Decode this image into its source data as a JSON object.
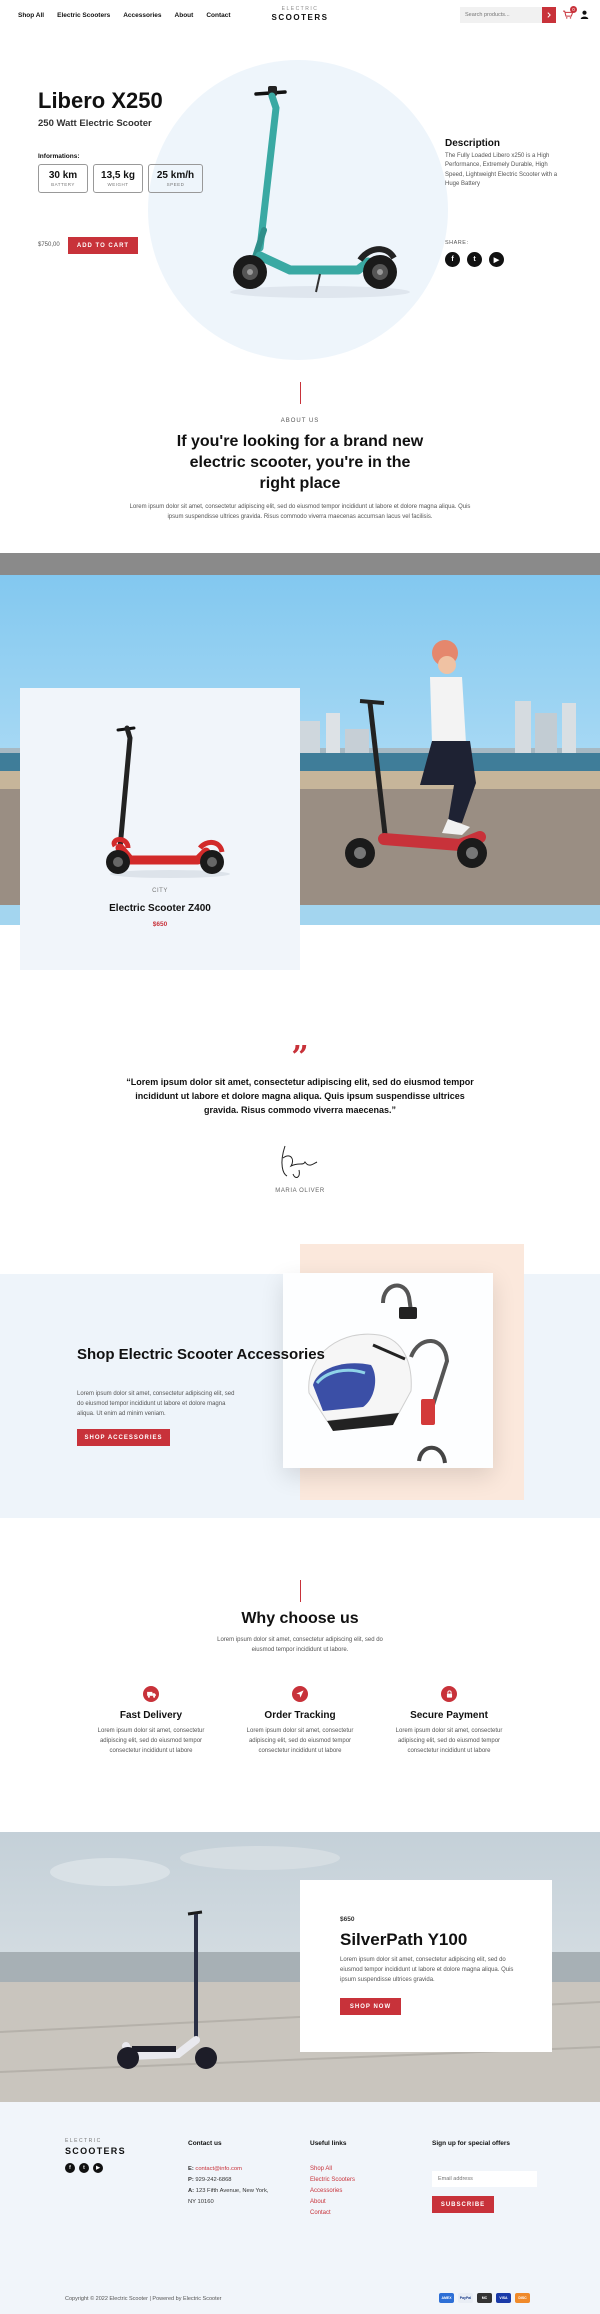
{
  "header": {
    "nav": [
      "Shop All",
      "Electric Scooters",
      "Accessories",
      "About",
      "Contact"
    ],
    "brand_small": "ELECTRIC",
    "brand_big": "SCOOTERS",
    "search_placeholder": "Search products...",
    "cart_count": "0"
  },
  "hero": {
    "title": "Libero X250",
    "subtitle": "250 Watt Electric Scooter",
    "info_label": "Informations:",
    "specs": [
      {
        "value": "30 km",
        "label": "BATTERY"
      },
      {
        "value": "13,5 kg",
        "label": "WEIGHT"
      },
      {
        "value": "25 km/h",
        "label": "SPEED"
      }
    ],
    "price": "$750,00",
    "add_to_cart": "ADD TO CART",
    "description_title": "Description",
    "description_text": "The Fully Loaded Libero x250 is a High Performance, Extremely Durable, High Speed, Lightweight Electric Scooter with a Huge Battery",
    "share_label": "SHARE:"
  },
  "about": {
    "label": "ABOUT US",
    "title": "If you're looking for a brand new electric scooter, you're in the right place",
    "text": "Lorem ipsum dolor sit amet, consectetur adipiscing elit, sed do eiusmod tempor incididunt ut labore et dolore magna aliqua. Quis ipsum suspendisse ultrices gravida. Risus commodo viverra maecenas accumsan lacus vel facilisis."
  },
  "featured": {
    "category": "CITY",
    "name": "Electric Scooter Z400",
    "price": "$650"
  },
  "testimonial": {
    "quote": "“Lorem ipsum dolor sit amet, consectetur adipiscing elit, sed do eiusmod tempor incididunt ut labore et dolore magna aliqua. Quis ipsum suspendisse ultrices gravida. Risus commodo viverra maecenas.”",
    "name": "MARIA OLIVER"
  },
  "accessories": {
    "title": "Shop Electric Scooter Accessories",
    "text": "Lorem ipsum dolor sit amet, consectetur adipiscing elit, sed do eiusmod tempor incididunt ut labore et dolore magna aliqua. Ut enim ad minim veniam.",
    "button": "SHOP ACCESSORIES"
  },
  "why": {
    "title": "Why choose us",
    "subtitle": "Lorem ipsum dolor sit amet, consectetur adipiscing elit, sed do eiusmod tempor incididunt ut labore.",
    "features": [
      {
        "title": "Fast Delivery",
        "text": "Lorem ipsum dolor sit amet, consectetur adipiscing elit, sed do eiusmod tempor consectetur incididunt ut labore",
        "icon": "truck-icon"
      },
      {
        "title": "Order Tracking",
        "text": "Lorem ipsum dolor sit amet, consectetur adipiscing elit, sed do eiusmod tempor consectetur incididunt ut labore",
        "icon": "navigation-icon"
      },
      {
        "title": "Secure Payment",
        "text": "Lorem ipsum dolor sit amet, consectetur adipiscing elit, sed do eiusmod tempor consectetur incididunt ut labore",
        "icon": "lock-icon"
      }
    ]
  },
  "product2": {
    "price": "$650",
    "title": "SilverPath Y100",
    "text": "Lorem ipsum dolor sit amet, consectetur adipiscing elit, sed do eiusmod tempor incididunt ut labore et dolore magna aliqua. Quis ipsum suspendisse ultrices gravida.",
    "button": "SHOP NOW"
  },
  "footer": {
    "brand_small": "ELECTRIC",
    "brand_big": "SCOOTERS",
    "contact_title": "Contact us",
    "email_label": "E:",
    "email": "contact@info.com",
    "phone_label": "P:",
    "phone": "929-242-6868",
    "address_label": "A:",
    "address_1": "123 Fifth Avenue, New York,",
    "address_2": "NY 10160",
    "links_title": "Useful links",
    "links": [
      "Shop All",
      "Electric Scooters",
      "Accessories",
      "About",
      "Contact"
    ],
    "signup_title": "Sign up for special offers",
    "email_placeholder": "Email address",
    "subscribe": "SUBSCRIBE",
    "copyright": "Copyright © 2022 Electric Scooter | Powered by Electric Scooter",
    "payments": [
      "AMEX",
      "PayPal",
      "MC",
      "VISA",
      "DISC"
    ]
  },
  "colors": {
    "accent": "#c8323a",
    "teal": "#3aa9a3",
    "light_bg": "#f1f5fa",
    "peach": "#fbe8dc"
  }
}
